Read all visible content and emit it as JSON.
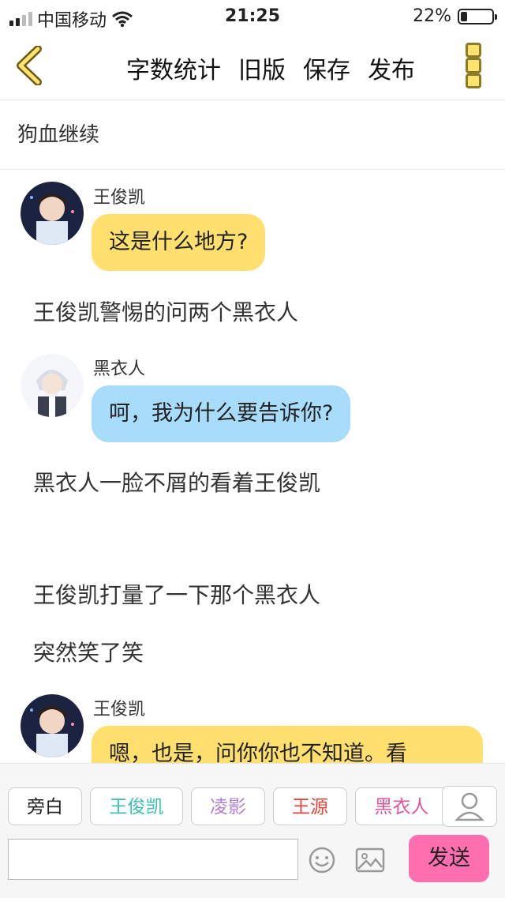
{
  "status": {
    "carrier": "中国移动",
    "time": "21:25",
    "battery": "22%",
    "battery_level": 0.22
  },
  "nav": {
    "back_icon": "chevron-left-icon",
    "word_count": "字数统计",
    "old_version": "旧版",
    "save": "保存",
    "publish": "发布",
    "more_icon": "more-vertical-icon",
    "accent": "#ffe36d"
  },
  "chapter": {
    "title": "狗血继续"
  },
  "messages": [
    {
      "type": "dialog",
      "speaker": "王俊凯",
      "text": "这是什么地方?",
      "color": "#ffdf6e"
    },
    {
      "type": "narration",
      "text": "王俊凯警惕的问两个黑衣人"
    },
    {
      "type": "dialog",
      "speaker": "黑衣人",
      "text": "呵，我为什么要告诉你?",
      "color": "#a8dcfb"
    },
    {
      "type": "narration",
      "text": "黑衣人一脸不屑的看着王俊凯"
    },
    {
      "type": "narration",
      "text": "王俊凯打量了一下那个黑衣人"
    },
    {
      "type": "narration",
      "text": "突然笑了笑"
    },
    {
      "type": "dialog",
      "speaker": "王俊凯",
      "text": "嗯，也是，问你你也不知道。看",
      "color": "#ffdf6e"
    }
  ],
  "toolbar": {
    "characters": [
      {
        "label": "旁白",
        "color": "#222222"
      },
      {
        "label": "王俊凯",
        "color": "#3bbfb1"
      },
      {
        "label": "凌影",
        "color": "#b07fd6"
      },
      {
        "label": "王源",
        "color": "#e0443a"
      },
      {
        "label": "黑衣人",
        "color": "#e0559a"
      }
    ],
    "person_icon": "person-icon",
    "input_value": "",
    "emoji_icon": "emoji-icon",
    "image_icon": "image-icon",
    "send": "发送",
    "send_color": "#ff6eaf"
  }
}
